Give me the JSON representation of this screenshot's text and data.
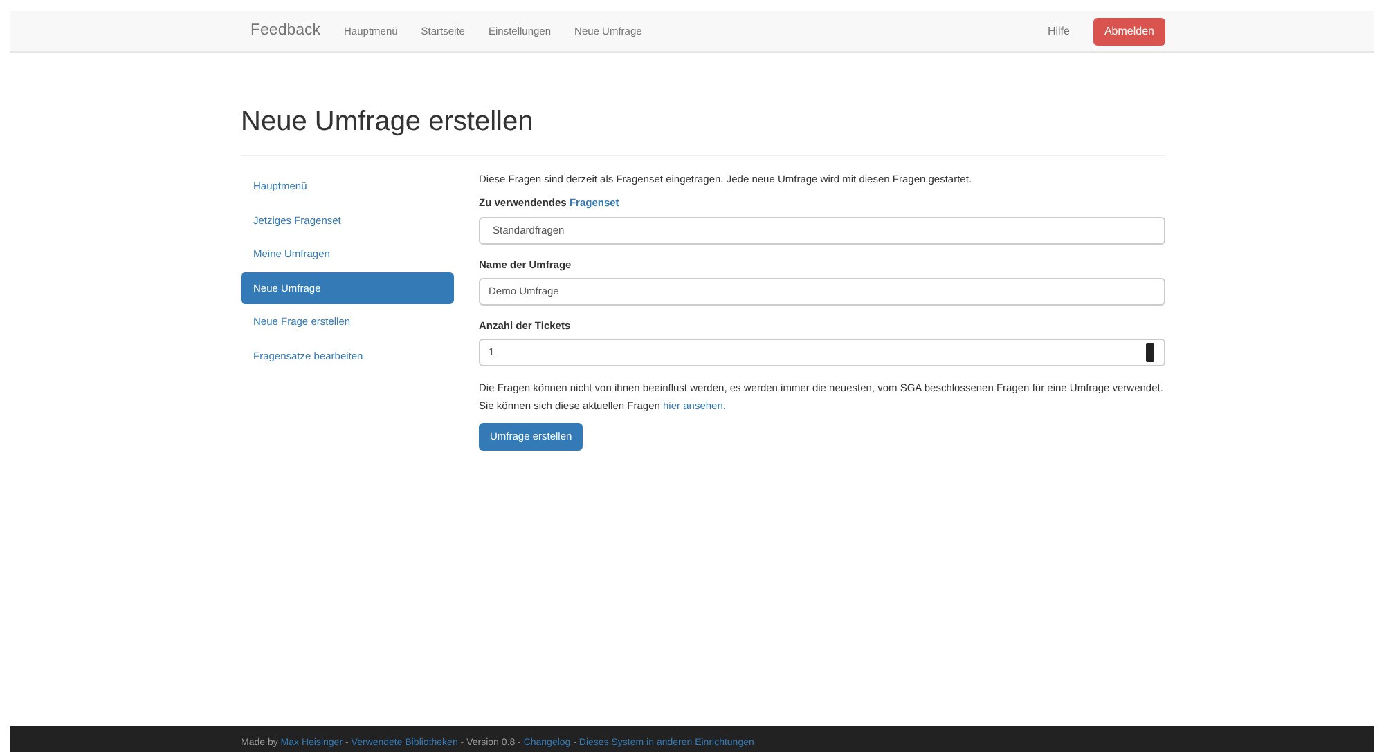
{
  "navbar": {
    "brand": "Feedback",
    "links": [
      {
        "label": "Hauptmenü"
      },
      {
        "label": "Startseite"
      },
      {
        "label": "Einstellungen"
      },
      {
        "label": "Neue Umfrage"
      }
    ],
    "help": "Hilfe",
    "logout": "Abmelden"
  },
  "heading": "Neue Umfrage erstellen",
  "sidebar": {
    "items": [
      {
        "label": "Hauptmenü",
        "selected": false
      },
      {
        "label": "Jetziges Fragenset",
        "selected": false
      },
      {
        "label": "Meine Umfragen",
        "selected": false
      },
      {
        "label": "Neue Umfrage",
        "selected": true
      },
      {
        "label": "Neue Frage erstellen",
        "selected": false
      },
      {
        "label": "Fragensätze bearbeiten",
        "selected": false
      }
    ]
  },
  "form": {
    "intro": "Diese Fragen sind derzeit als Fragenset eingetragen. Jede neue Umfrage wird mit diesen Fragen gestartet.",
    "fields": [
      {
        "kind": "select",
        "label": "Zu verwendendes ",
        "label_link": "Fragenset",
        "value": "Standardfragen"
      },
      {
        "kind": "text",
        "label": "Name der Umfrage",
        "value": "Demo Umfrage"
      },
      {
        "kind": "number",
        "label": "Anzahl der Tickets",
        "value": "1"
      }
    ],
    "note": "Die Fragen können nicht von ihnen beeinflust werden, es werden immer die neuesten, vom SGA beschlossenen Fragen für eine Umfrage verwendet. Sie können sich diese aktuellen Fragen ",
    "note_link": "hier ansehen.",
    "submit": "Umfrage erstellen"
  },
  "footer": [
    {
      "kind": "text",
      "text": "Made by "
    },
    {
      "kind": "link",
      "text": "Max Heisinger"
    },
    {
      "kind": "text",
      "text": " - "
    },
    {
      "kind": "link",
      "text": "Verwendete Bibliotheken"
    },
    {
      "kind": "text",
      "text": " - Version 0.8 - "
    },
    {
      "kind": "link",
      "text": "Changelog"
    },
    {
      "kind": "text",
      "text": " - "
    },
    {
      "kind": "link",
      "text": "Dieses System in anderen Einrichtungen"
    }
  ]
}
